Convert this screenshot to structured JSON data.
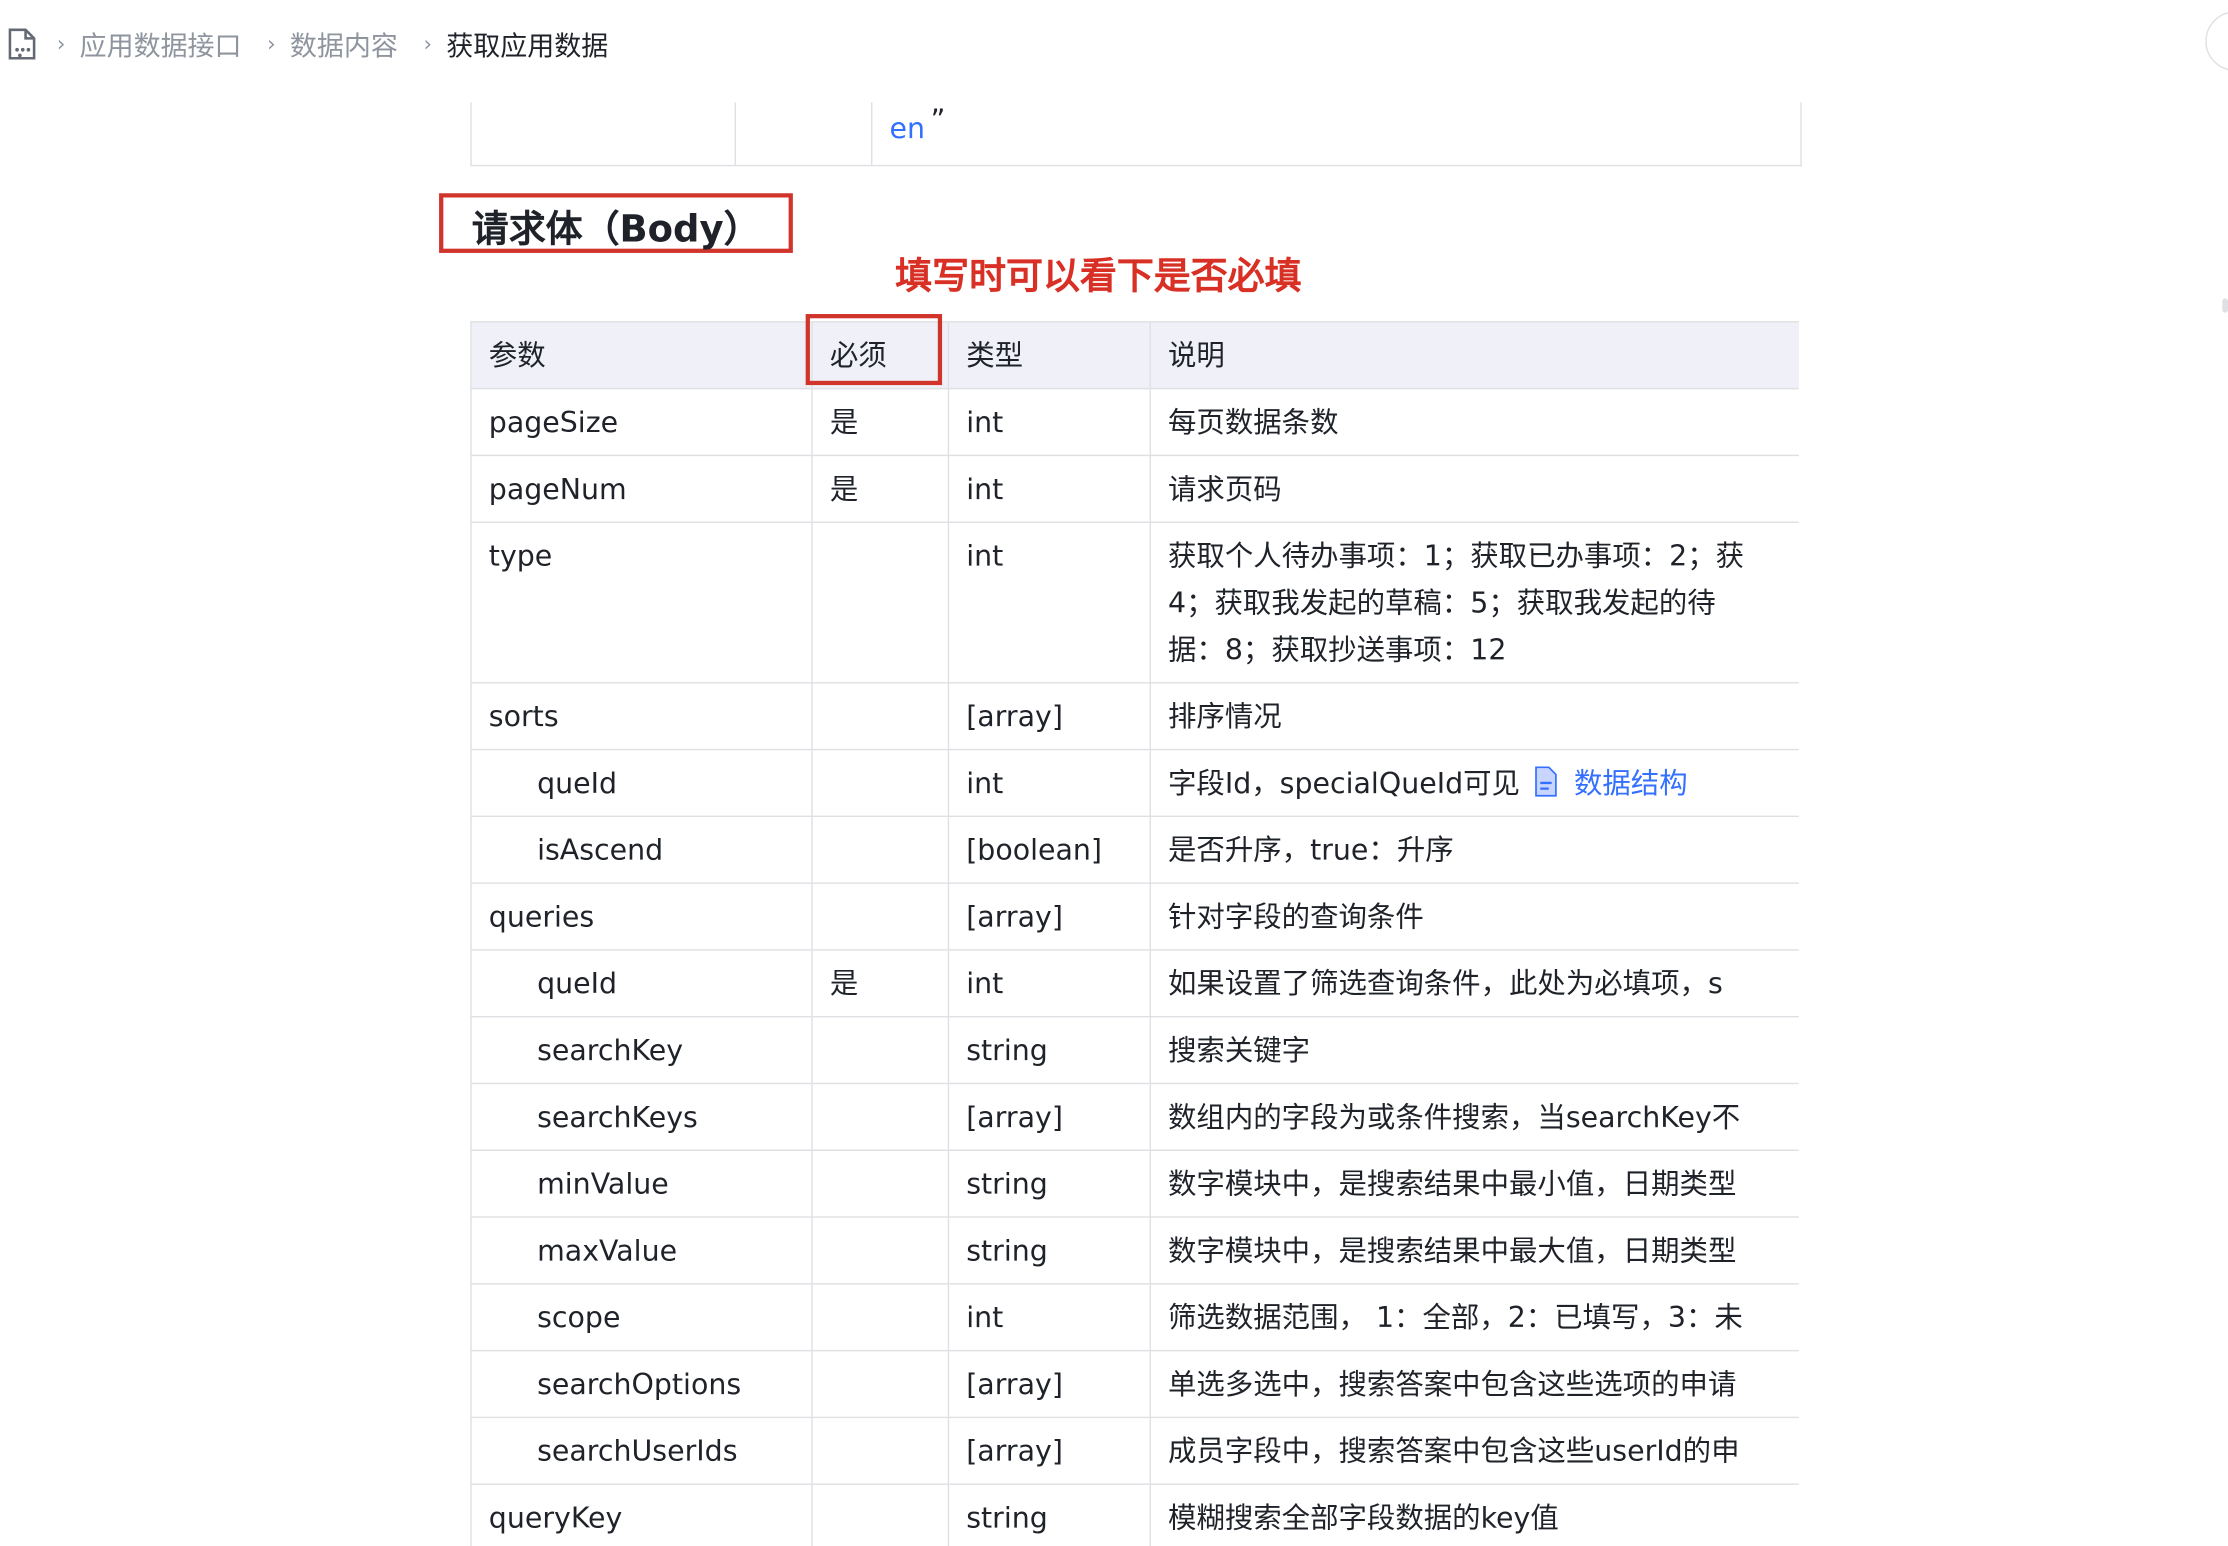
{
  "breadcrumb": {
    "items": [
      "应用数据接口",
      "数据内容",
      "获取应用数据"
    ],
    "separator": "›"
  },
  "top_fragment": {
    "text": "en",
    "quote": "”"
  },
  "section": {
    "heading": "请求体（Body）",
    "annotation": "填写时可以看下是否必填"
  },
  "table": {
    "headers": [
      "参数",
      "必须",
      "类型",
      "说明"
    ],
    "rows": [
      {
        "param": "pageSize",
        "required": "是",
        "type": "int",
        "desc": "每页数据条数"
      },
      {
        "param": "pageNum",
        "required": "是",
        "type": "int",
        "desc": "请求页码"
      },
      {
        "param": "type",
        "required": "",
        "type": "int",
        "desc_lines": [
          "获取个人待办事项：1；获取已办事项：2；获",
          "4；获取我发起的草稿：5；获取我发起的待",
          "据：8；获取抄送事项：12"
        ]
      },
      {
        "param": "sorts",
        "required": "",
        "type": "[array]",
        "desc": "排序情况"
      },
      {
        "param": "queId",
        "required": "",
        "type": "int",
        "desc": "字段Id，specialQueId可见",
        "link": "数据结构"
      },
      {
        "param": "isAscend",
        "required": "",
        "type": "[boolean]",
        "desc": "是否升序，true：升序"
      },
      {
        "param": "queries",
        "required": "",
        "type": "[array]",
        "desc": "针对字段的查询条件"
      },
      {
        "param": "queId",
        "required": "是",
        "type": "int",
        "desc": "如果设置了筛选查询条件，此处为必填项，s"
      },
      {
        "param": "searchKey",
        "required": "",
        "type": "string",
        "desc": "搜索关键字"
      },
      {
        "param": "searchKeys",
        "required": "",
        "type": "[array]",
        "desc": "数组内的字段为或条件搜索，当searchKey不"
      },
      {
        "param": "minValue",
        "required": "",
        "type": "string",
        "desc": "数字模块中，是搜索结果中最小值，日期类型"
      },
      {
        "param": "maxValue",
        "required": "",
        "type": "string",
        "desc": "数字模块中，是搜索结果中最大值，日期类型"
      },
      {
        "param": "scope",
        "required": "",
        "type": "int",
        "desc": "筛选数据范围， 1：全部，2：已填写，3：未"
      },
      {
        "param": "searchOptions",
        "required": "",
        "type": "[array]",
        "desc": "单选多选中，搜索答案中包含这些选项的申请"
      },
      {
        "param": "searchUserIds",
        "required": "",
        "type": "[array]",
        "desc": "成员字段中，搜索答案中包含这些userId的申"
      },
      {
        "param": "queryKey",
        "required": "",
        "type": "string",
        "desc": "模糊搜索全部字段数据的key值"
      }
    ]
  },
  "colors": {
    "annotation_red": "#d93026",
    "box_red": "#d1342b",
    "link_blue": "#3370ff",
    "header_bg": "#eff0f8"
  }
}
